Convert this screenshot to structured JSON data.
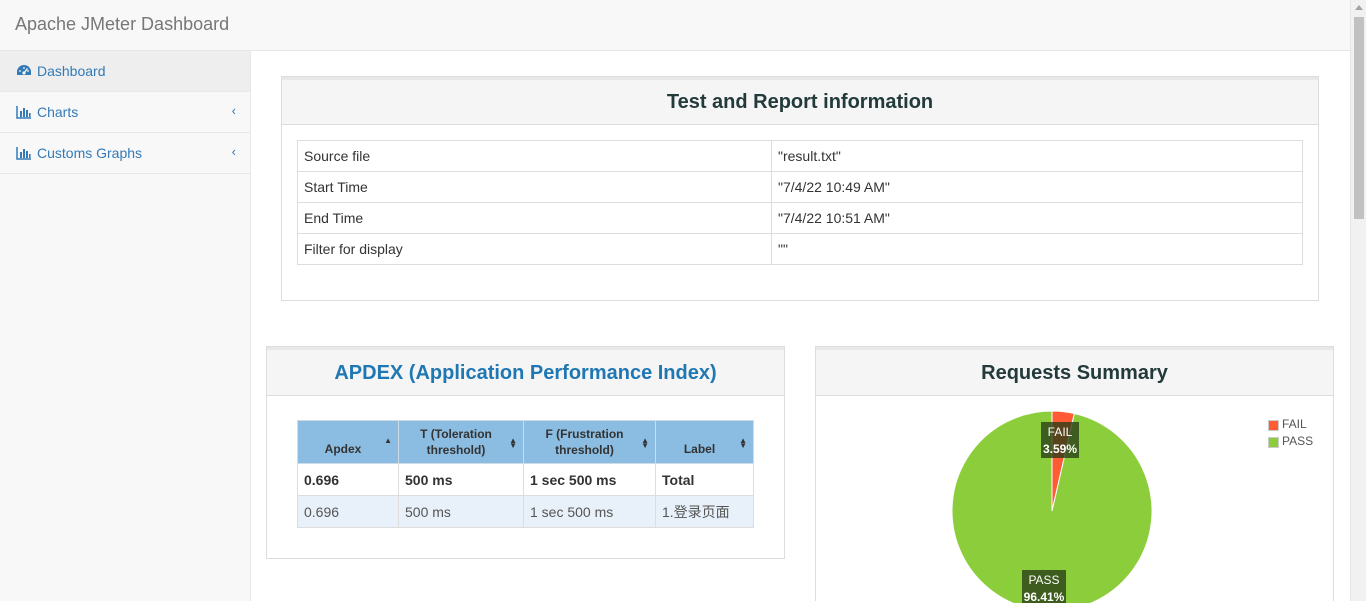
{
  "app": {
    "title": "Apache JMeter Dashboard"
  },
  "sidebar": {
    "items": [
      {
        "label": "Dashboard",
        "icon": "dashboard-icon"
      },
      {
        "label": "Charts",
        "icon": "bar-chart-icon",
        "expand_glyph": "‹"
      },
      {
        "label": "Customs Graphs",
        "icon": "bar-chart-icon",
        "expand_glyph": "‹"
      }
    ]
  },
  "info": {
    "title": "Test and Report information",
    "rows": [
      {
        "key": "Source file",
        "value": "\"result.txt\""
      },
      {
        "key": "Start Time",
        "value": "\"7/4/22 10:49 AM\""
      },
      {
        "key": "End Time",
        "value": "\"7/4/22 10:51 AM\""
      },
      {
        "key": "Filter for display",
        "value": "\"\""
      }
    ]
  },
  "apdex": {
    "title": "APDEX (Application Performance Index)",
    "columns": [
      "Apdex",
      "T (Toleration threshold)",
      "F (Frustration threshold)",
      "Label"
    ],
    "rows": [
      [
        "0.696",
        "500 ms",
        "1 sec 500 ms",
        "Total"
      ],
      [
        "0.696",
        "500 ms",
        "1 sec 500 ms",
        "1.登录页面"
      ]
    ]
  },
  "summary": {
    "title": "Requests Summary",
    "chart_data": {
      "type": "pie",
      "title": "Requests Summary",
      "series": [
        {
          "name": "FAIL",
          "value": 3.59,
          "label": "FAIL",
          "pct_label": "3.59%",
          "color": "#ff5c35"
        },
        {
          "name": "PASS",
          "value": 96.41,
          "label": "PASS",
          "pct_label": "96.41%",
          "color": "#8ccd3c"
        }
      ],
      "legend": "top-right"
    }
  },
  "colors": {
    "accent": "#337ab7",
    "apdex_title": "#1f77b4",
    "header_cell": "#8bbce1"
  }
}
